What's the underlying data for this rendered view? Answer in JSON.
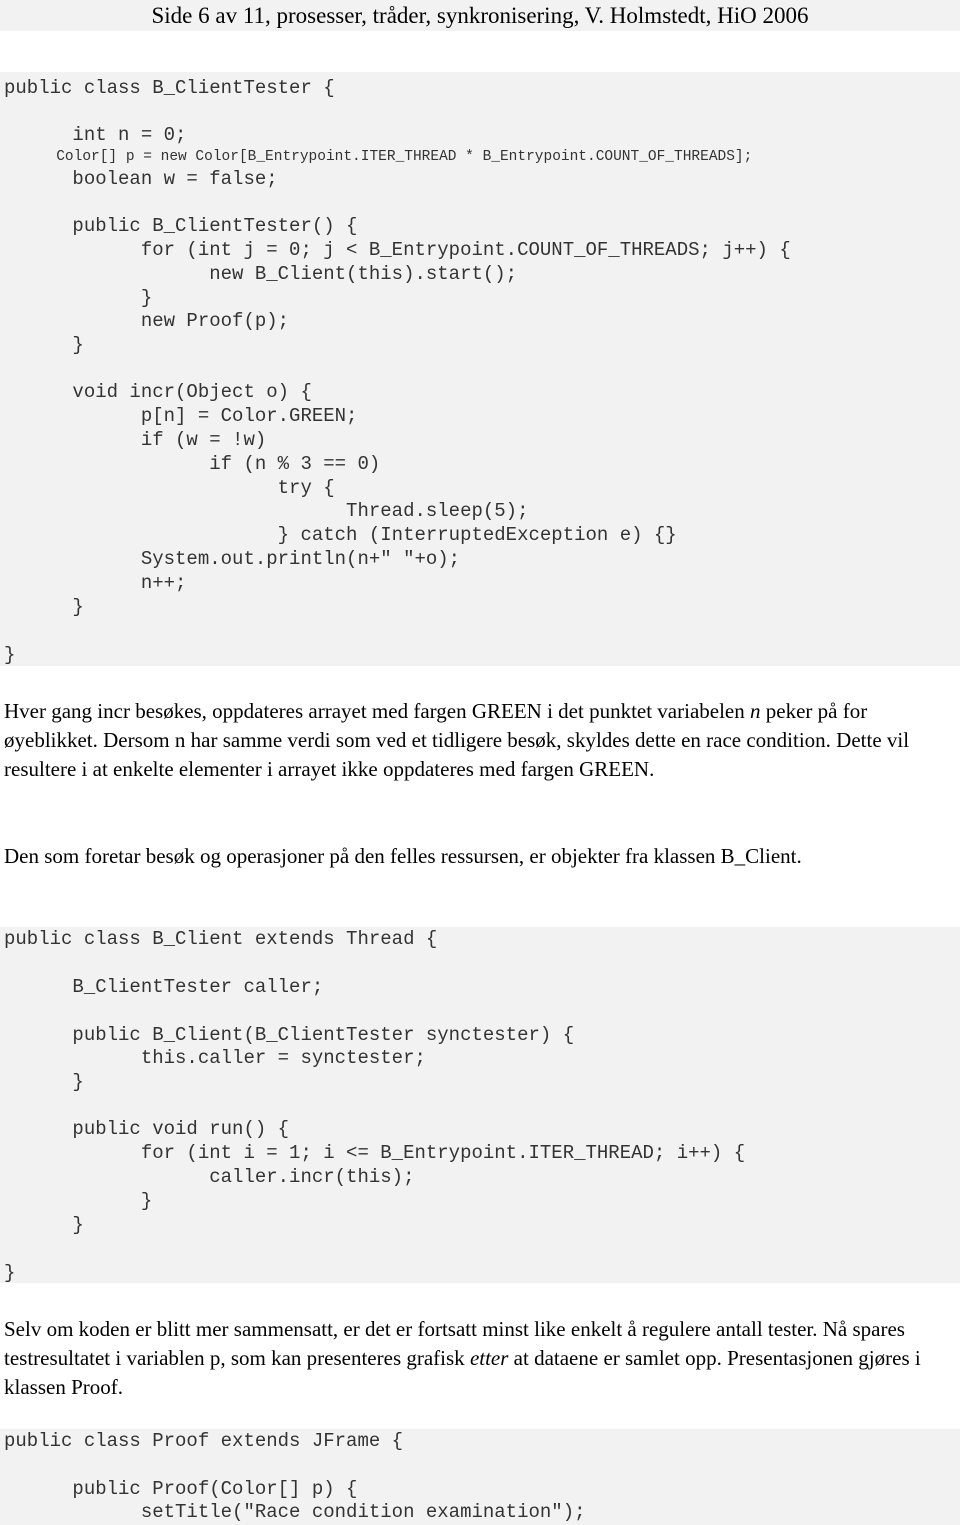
{
  "header": {
    "title": "Side 6 av 11, prosesser, tråder, synkronisering, V. Holmstedt, HiO 2006"
  },
  "code_blocks": [
    {
      "name": "b-clienttester-code",
      "lines": [
        "public class B_ClientTester {",
        "",
        "      int n = 0;",
        "      Color[] p = new Color[B_Entrypoint.ITER_THREAD * B_Entrypoint.COUNT_OF_THREADS];",
        "      boolean w = false;",
        "",
        "      public B_ClientTester() {",
        "            for (int j = 0; j < B_Entrypoint.COUNT_OF_THREADS; j++) {",
        "                  new B_Client(this).start();",
        "            }",
        "            new Proof(p);",
        "      }",
        "",
        "      void incr(Object o) {",
        "            p[n] = Color.GREEN;",
        "            if (w = !w)",
        "                  if (n % 3 == 0)",
        "                        try {",
        "                              Thread.sleep(5);",
        "                        } catch (InterruptedException e) {}",
        "            System.out.println(n+\" \"+o);",
        "            n++;",
        "      }",
        "",
        "}"
      ]
    },
    {
      "name": "b-client-code",
      "lines": [
        "public class B_Client extends Thread {",
        "",
        "      B_ClientTester caller;",
        "",
        "      public B_Client(B_ClientTester synctester) {",
        "            this.caller = synctester;",
        "      }",
        "",
        "      public void run() {",
        "            for (int i = 1; i <= B_Entrypoint.ITER_THREAD; i++) {",
        "                  caller.incr(this);",
        "            }",
        "      }",
        "",
        "}"
      ]
    },
    {
      "name": "proof-code",
      "lines": [
        "public class Proof extends JFrame {",
        "",
        "      public Proof(Color[] p) {",
        "            setTitle(\"Race condition examination\");"
      ]
    }
  ],
  "paragraphs": {
    "p1": {
      "text_before_italic": "Hver gang incr besøkes, oppdateres arrayet med fargen GREEN i det punktet variabelen ",
      "italic": "n",
      "text_after_italic": " peker på for øyeblikket. Dersom n har samme verdi som ved et tidligere besøk, skyldes dette en race condition. Dette vil resultere i at enkelte elementer i arrayet ikke oppdateres med fargen GREEN."
    },
    "p2": {
      "text": "Den som foretar besøk og operasjoner på den felles ressursen, er objekter fra klassen B_Client."
    },
    "p3": {
      "text_before_italic": "Selv om koden er blitt mer sammensatt, er det er fortsatt minst like enkelt å regulere antall tester. Nå spares testresultatet i variablen p, som kan presenteres grafisk ",
      "italic": "etter",
      "text_after_italic": " at dataene er samlet opp. Presentasjonen gjøres i klassen Proof."
    }
  }
}
